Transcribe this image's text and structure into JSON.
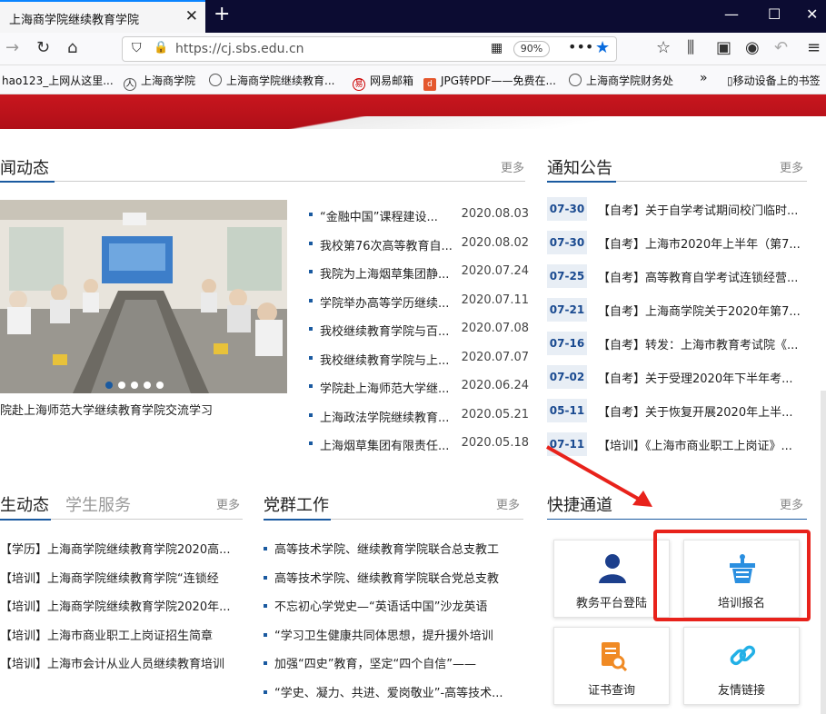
{
  "browser": {
    "tab_title": "上海商学院继续教育学院",
    "url": "https://cj.sbs.edu.cn",
    "zoom": "90%",
    "bookmarks": [
      "hao123_上网从这里...",
      "上海商学院",
      "上海商学院继续教育...",
      "网易邮箱",
      "JPG转PDF——免费在...",
      "上海商学院财务处",
      "移动设备上的书签"
    ]
  },
  "news": {
    "title": "闻动态",
    "more": "更多",
    "caption": "院赴上海师范大学继续教育学院交流学习",
    "items": [
      {
        "text": "“金融中国”课程建设...",
        "date": "2020.08.03"
      },
      {
        "text": "我校第76次高等教育自...",
        "date": "2020.08.02"
      },
      {
        "text": "我院为上海烟草集团静...",
        "date": "2020.07.24"
      },
      {
        "text": "学院举办高等学历继续...",
        "date": "2020.07.11"
      },
      {
        "text": "我校继续教育学院与百...",
        "date": "2020.07.08"
      },
      {
        "text": "我校继续教育学院与上...",
        "date": "2020.07.07"
      },
      {
        "text": "学院赴上海师范大学继...",
        "date": "2020.06.24"
      },
      {
        "text": "上海政法学院继续教育...",
        "date": "2020.05.21"
      },
      {
        "text": "上海烟草集团有限责任...",
        "date": "2020.05.18"
      }
    ]
  },
  "notice": {
    "title": "通知公告",
    "more": "更多",
    "items": [
      {
        "date": "07-30",
        "text": "【自考】关于自学考试期间校门临时..."
      },
      {
        "date": "07-30",
        "text": "【自考】上海市2020年上半年（第7..."
      },
      {
        "date": "07-25",
        "text": "【自考】高等教育自学考试连锁经营..."
      },
      {
        "date": "07-21",
        "text": "【自考】上海商学院关于2020年第7..."
      },
      {
        "date": "07-16",
        "text": "【自考】转发：上海市教育考试院《..."
      },
      {
        "date": "07-02",
        "text": "【自考】关于受理2020年下半年考..."
      },
      {
        "date": "05-11",
        "text": "【自考】关于恢复开展2020年上半..."
      },
      {
        "date": "07-11",
        "text": "【培训】《上海市商业职工上岗证》..."
      }
    ]
  },
  "student": {
    "tab_active": "生动态",
    "tab_other": "学生服务",
    "more": "更多",
    "items": [
      "【学历】上海商学院继续教育学院2020高...",
      "【培训】上海商学院继续教育学院“连锁经",
      "【培训】上海商学院继续教育学院2020年...",
      "【培训】上海市商业职工上岗证招生简章",
      "【培训】上海市会计从业人员继续教育培训"
    ]
  },
  "party": {
    "title": "党群工作",
    "more": "更多",
    "items": [
      "高等技术学院、继续教育学院联合总支教工",
      "高等技术学院、继续教育学院联合党总支教",
      "不忘初心学党史—“英语话中国”沙龙英语",
      "“学习卫生健康共同体思想，提升援外培训",
      "加强“四史”教育，坚定“四个自信”——",
      "“学史、凝力、共进、爱岗敬业”-高等技术..."
    ]
  },
  "quick": {
    "title": "快捷通道",
    "more": "更多",
    "cards": [
      "教务平台登陆",
      "培训报名",
      "证书查询",
      "友情链接"
    ]
  },
  "colors": {
    "accent": "#1a5aa0",
    "highlight": "#e8221b",
    "banner": "#c8161e"
  }
}
